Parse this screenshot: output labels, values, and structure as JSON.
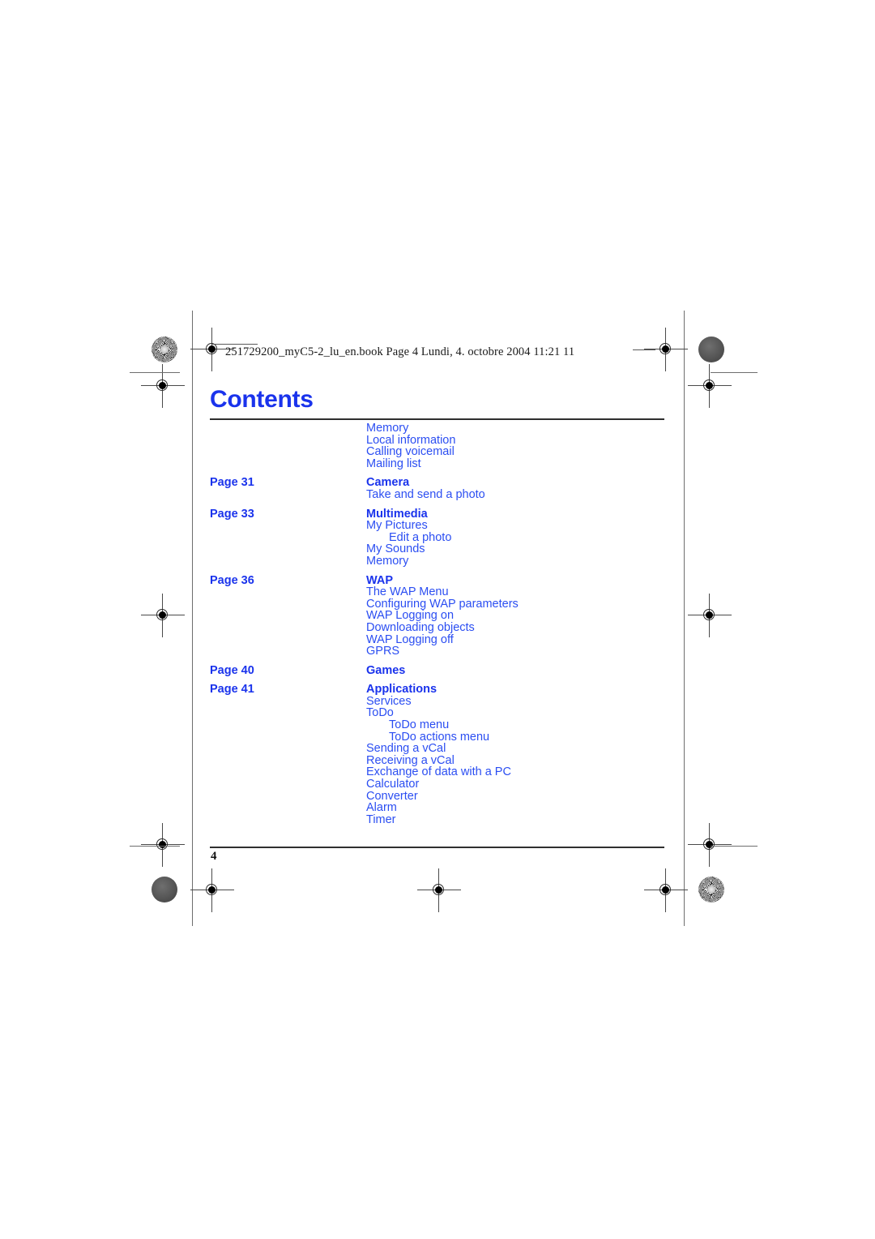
{
  "document": {
    "slug_line": "251729200_myC5-2_lu_en.book  Page 4  Lundi, 4. octobre 2004  11:21 11",
    "title": "Contents",
    "folio": "4",
    "accent_color": "#1a33ec",
    "body_color": "#2b4ef2",
    "rule_color": "#2f2f2f"
  },
  "toc": {
    "rows": [
      {
        "page": "",
        "entry": "Memory",
        "level": 2,
        "gap": false
      },
      {
        "page": "",
        "entry": "Local information",
        "level": 2,
        "gap": false
      },
      {
        "page": "",
        "entry": "Calling voicemail",
        "level": 2,
        "gap": false
      },
      {
        "page": "",
        "entry": "Mailing list",
        "level": 2,
        "gap": false
      },
      {
        "page": "Page 31",
        "entry": "Camera",
        "level": 1,
        "gap": true
      },
      {
        "page": "",
        "entry": "Take and send a photo",
        "level": 2,
        "gap": false
      },
      {
        "page": "Page 33",
        "entry": "Multimedia",
        "level": 1,
        "gap": true
      },
      {
        "page": "",
        "entry": "My Pictures",
        "level": 2,
        "gap": false
      },
      {
        "page": "",
        "entry": "Edit a photo",
        "level": 3,
        "gap": false
      },
      {
        "page": "",
        "entry": "My Sounds",
        "level": 2,
        "gap": false
      },
      {
        "page": "",
        "entry": "Memory",
        "level": 2,
        "gap": false
      },
      {
        "page": "Page 36",
        "entry": "WAP",
        "level": 1,
        "gap": true
      },
      {
        "page": "",
        "entry": "The WAP Menu",
        "level": 2,
        "gap": false
      },
      {
        "page": "",
        "entry": "Configuring WAP parameters",
        "level": 2,
        "gap": false
      },
      {
        "page": "",
        "entry": "WAP Logging on",
        "level": 2,
        "gap": false
      },
      {
        "page": "",
        "entry": "Downloading objects",
        "level": 2,
        "gap": false
      },
      {
        "page": "",
        "entry": "WAP Logging off",
        "level": 2,
        "gap": false
      },
      {
        "page": "",
        "entry": "GPRS",
        "level": 2,
        "gap": false
      },
      {
        "page": "Page 40",
        "entry": "Games",
        "level": 1,
        "gap": true
      },
      {
        "page": "Page 41",
        "entry": "Applications",
        "level": 1,
        "gap": true
      },
      {
        "page": "",
        "entry": "Services",
        "level": 2,
        "gap": false
      },
      {
        "page": "",
        "entry": "ToDo",
        "level": 2,
        "gap": false
      },
      {
        "page": "",
        "entry": "ToDo menu",
        "level": 3,
        "gap": false
      },
      {
        "page": "",
        "entry": "ToDo actions menu",
        "level": 3,
        "gap": false
      },
      {
        "page": "",
        "entry": "Sending a vCal",
        "level": 2,
        "gap": false
      },
      {
        "page": "",
        "entry": "Receiving a vCal",
        "level": 2,
        "gap": false
      },
      {
        "page": "",
        "entry": "Exchange of data with a PC",
        "level": 2,
        "gap": false
      },
      {
        "page": "",
        "entry": "Calculator",
        "level": 2,
        "gap": false
      },
      {
        "page": "",
        "entry": "Converter",
        "level": 2,
        "gap": false
      },
      {
        "page": "",
        "entry": "Alarm",
        "level": 2,
        "gap": false
      },
      {
        "page": "",
        "entry": "Timer",
        "level": 2,
        "gap": false
      }
    ]
  },
  "print_marks": {
    "registration_targets": 8,
    "star_targets": 2,
    "solid_targets": 2
  }
}
